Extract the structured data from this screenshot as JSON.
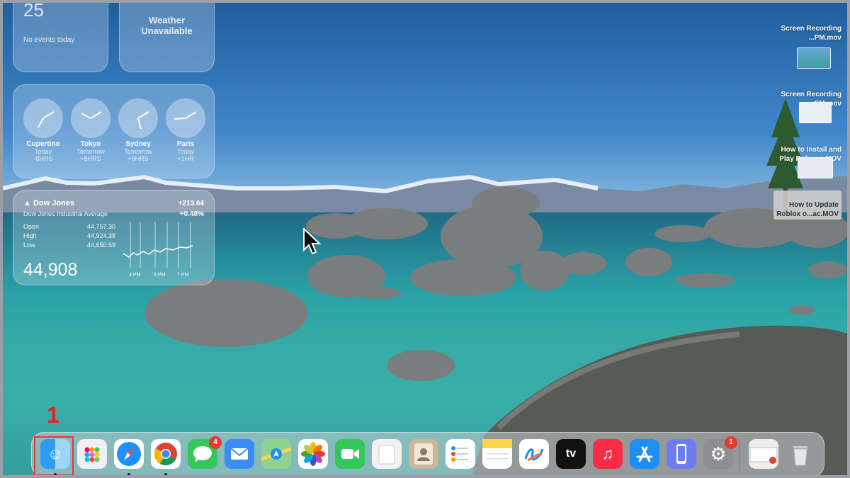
{
  "widgets": {
    "calendar": {
      "day_number": "25",
      "events_text": "No events today"
    },
    "weather": {
      "text": "Weather\nUnavailable"
    },
    "world_clock": {
      "clocks": [
        {
          "city": "Cupertino",
          "day": "Today",
          "offset": "-8HRS"
        },
        {
          "city": "Tokyo",
          "day": "Tomorrow",
          "offset": "+8HRS"
        },
        {
          "city": "Sydney",
          "day": "Tomorrow",
          "offset": "+9HRS"
        },
        {
          "city": "Paris",
          "day": "Today",
          "offset": "+1HR"
        }
      ]
    },
    "stocks": {
      "name": "▲ Dow Jones",
      "full_name": "Dow Jones Industrial Average",
      "change": "+213.64",
      "change_pct": "+0.48%",
      "open_label": "Open",
      "open_value": "44,757.30",
      "high_label": "High",
      "high_value": "44,924.38",
      "low_label": "Low",
      "low_value": "44,650.59",
      "value": "44,908",
      "time_labels": [
        "3 PM",
        "5 PM",
        "7 PM"
      ]
    }
  },
  "desktop_items": [
    {
      "label": "Screen Recording\n...PM.mov"
    },
    {
      "label": "Screen Recording\n...PM.mov"
    },
    {
      "label": "How to Install and\nPlay Rob...ac.MOV"
    },
    {
      "label": "How to Update\nRoblox o...ac.MOV"
    }
  ],
  "annotation": {
    "step_number": "1"
  },
  "dock": {
    "apps": [
      {
        "name": "Finder",
        "icon": "finder-icon",
        "color": "#1e88e5",
        "running": true,
        "highlighted": true
      },
      {
        "name": "Launchpad",
        "icon": "launchpad-icon",
        "color": "#eef0f3"
      },
      {
        "name": "Safari",
        "icon": "safari-icon",
        "color": "#ffffff",
        "running": true
      },
      {
        "name": "Google Chrome",
        "icon": "chrome-icon",
        "color": "#ffffff",
        "running": true
      },
      {
        "name": "Messages",
        "icon": "messages-icon",
        "color": "#34c759",
        "badge": "4"
      },
      {
        "name": "Mail",
        "icon": "mail-icon",
        "color": "#3a8df5"
      },
      {
        "name": "Maps",
        "icon": "maps-icon",
        "color": "#6cc36c"
      },
      {
        "name": "Photos",
        "icon": "photos-icon",
        "color": "#ffffff"
      },
      {
        "name": "FaceTime",
        "icon": "facetime-icon",
        "color": "#34c759"
      },
      {
        "name": "Preview",
        "icon": "preview-icon",
        "color": "#f2f2f2"
      },
      {
        "name": "Contacts",
        "icon": "contacts-icon",
        "color": "#c9b899"
      },
      {
        "name": "Reminders",
        "icon": "reminders-icon",
        "color": "#ffffff"
      },
      {
        "name": "Notes",
        "icon": "notes-icon",
        "color": "#fbd54a"
      },
      {
        "name": "Freeform",
        "icon": "freeform-icon",
        "color": "#ffffff"
      },
      {
        "name": "Apple TV",
        "icon": "appletv-icon",
        "color": "#111111",
        "text": "tv"
      },
      {
        "name": "Music",
        "icon": "music-icon",
        "color": "#fa2d48"
      },
      {
        "name": "App Store",
        "icon": "appstore-icon",
        "color": "#1d8ef2"
      },
      {
        "name": "iPhone Mirroring",
        "icon": "iphone-mirroring-icon",
        "color": "#6d7cf0"
      },
      {
        "name": "System Settings",
        "icon": "settings-icon",
        "color": "#8e8e93",
        "badge": "1"
      },
      {
        "name": "Downloads Stack",
        "icon": "stack-icon",
        "color": "#eeeeee"
      },
      {
        "name": "Trash",
        "icon": "trash-icon",
        "color": "#d9dde2"
      }
    ]
  }
}
